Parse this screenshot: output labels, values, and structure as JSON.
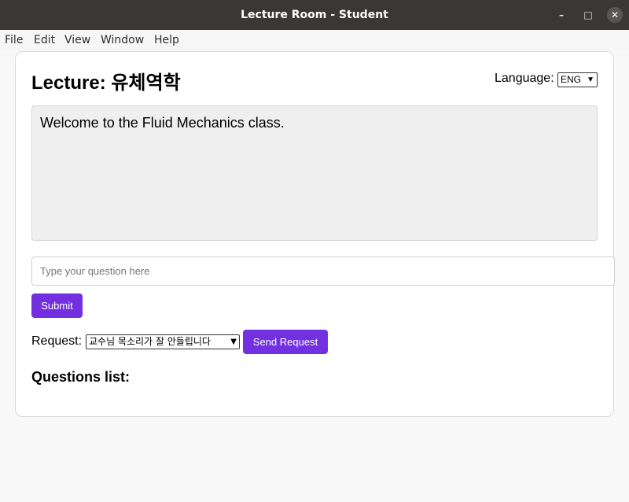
{
  "window": {
    "title": "Lecture Room - Student",
    "minimize_glyph": "–",
    "maximize_glyph": "□",
    "close_glyph": "✕"
  },
  "menu": {
    "file": "File",
    "edit": "Edit",
    "view": "View",
    "window": "Window",
    "help": "Help"
  },
  "header": {
    "lecture_title": "Lecture: 유체역학",
    "language_label": "Language:",
    "language_value": "ENG"
  },
  "content": {
    "message": "Welcome to the Fluid Mechanics class."
  },
  "question_form": {
    "placeholder": "Type your question here",
    "value": "",
    "submit_label": "Submit"
  },
  "request": {
    "label": "Request:",
    "selected": "교수님 목소리가 잘 안들립니다",
    "send_label": "Send Request"
  },
  "questions": {
    "heading": "Questions list:",
    "items": []
  },
  "colors": {
    "accent": "#7230e0",
    "titlebar": "#3b3734"
  }
}
